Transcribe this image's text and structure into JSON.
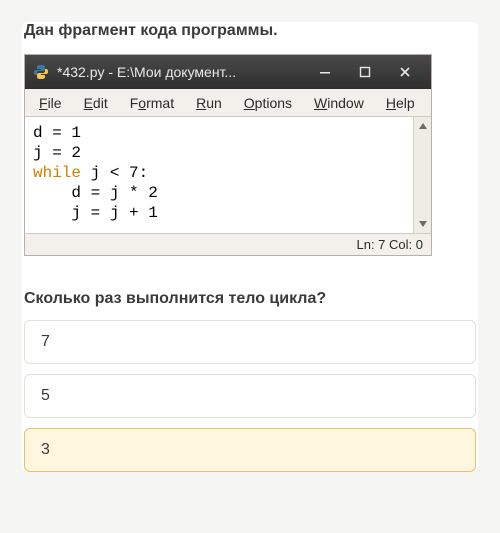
{
  "prompt": "Дан фрагмент кода программы.",
  "window": {
    "title": "*432.py - E:\\Мои документ...",
    "icon_name": "python-icon"
  },
  "menubar": [
    {
      "key": "F",
      "rest": "ile"
    },
    {
      "key": "E",
      "rest": "dit"
    },
    {
      "key": "F",
      "rest": "ormat",
      "leadpad": true
    },
    {
      "key": "R",
      "rest": "un"
    },
    {
      "key": "O",
      "rest": "ptions"
    },
    {
      "key": "W",
      "rest": "indow"
    },
    {
      "key": "H",
      "rest": "elp"
    }
  ],
  "code": {
    "line1": "d = 1",
    "line2": "j = 2",
    "line3a": "while",
    "line3b": " j < 7:",
    "line4": "    d = j * 2",
    "line5": "    j = j + 1"
  },
  "status": "Ln: 7  Col: 0",
  "question": "Сколько раз выполнится тело цикла?",
  "answers": [
    {
      "label": "7",
      "selected": false
    },
    {
      "label": "5",
      "selected": false
    },
    {
      "label": "3",
      "selected": true
    }
  ]
}
